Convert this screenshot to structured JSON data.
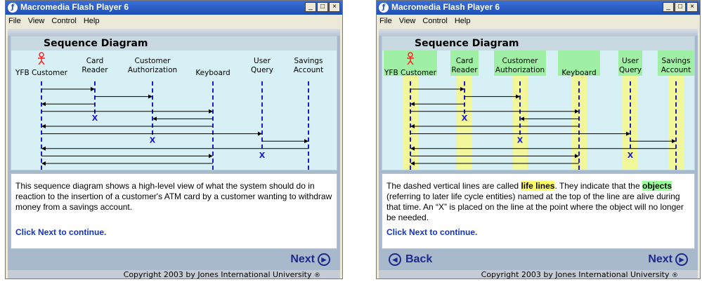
{
  "colors": {
    "title_bar": "#2452c0",
    "panel": "#d6f0f5",
    "lifeline": "#1c1ccc",
    "lane_highlight": "#f2f79a",
    "box_highlight": "#9ff0a4"
  },
  "windows": [
    {
      "title": "Macromedia Flash Player 6",
      "menu": [
        "File",
        "View",
        "Control",
        "Help"
      ],
      "heading": "Sequence Diagram",
      "description_parts": [
        {
          "text": "This sequence diagram shows a high-level view of what the system should do in reaction to the insertion of a customer's ATM card by a customer wanting to withdraw money from a savings account.",
          "style": "plain"
        }
      ],
      "cta": "Click Next to continue.",
      "next_label": "Next",
      "copyright": "Copyright 2003 by Jones International University",
      "registered_mark": "®"
    },
    {
      "title": "Macromedia Flash Player 6",
      "menu": [
        "File",
        "View",
        "Control",
        "Help"
      ],
      "heading": "Sequence Diagram",
      "description_parts": [
        {
          "text": "The dashed vertical lines are called ",
          "style": "plain"
        },
        {
          "text": "life lines",
          "style": "yellow"
        },
        {
          "text": ". They indicate that the ",
          "style": "plain"
        },
        {
          "text": "objects",
          "style": "green"
        },
        {
          "text": " (referring to later life cycle entities) named at the top of the line are alive during that time. An “X” is placed on the line at the point where the object will no longer be needed.",
          "style": "plain"
        }
      ],
      "cta": "Click Next to continue.",
      "back_label": "Back",
      "next_label": "Next",
      "copyright": "Copyright 2003 by Jones International University",
      "registered_mark": "®"
    }
  ],
  "window_controls": [
    "_",
    "□",
    "×"
  ],
  "icons": {
    "app": "flash-icon",
    "next": "next-arrow-icon",
    "back": "back-arrow-icon",
    "actor": "stick-figure-icon"
  },
  "diagram": {
    "objects": [
      [
        "YFB Customer"
      ],
      [
        "Card",
        "Reader"
      ],
      [
        "Customer",
        "Authorization"
      ],
      [
        "Keyboard"
      ],
      [
        "User",
        "Query"
      ],
      [
        "Savings",
        "Account"
      ]
    ],
    "messages": [
      {
        "from": 0,
        "to": 1
      },
      {
        "from": 1,
        "to": 2
      },
      {
        "from": 1,
        "to": 0
      },
      {
        "from": 0,
        "to": 3
      },
      {
        "from": 3,
        "to": 2
      },
      {
        "from": 3,
        "to": 0
      },
      {
        "from": 0,
        "to": 4
      },
      {
        "from": 4,
        "to": 5
      },
      {
        "from": 5,
        "to": 0
      },
      {
        "from": 0,
        "to": 3
      },
      {
        "from": 3,
        "to": 0
      }
    ],
    "destructions": [
      {
        "object": 1,
        "after_message": 3
      },
      {
        "object": 2,
        "after_message": 6
      },
      {
        "object": 4,
        "after_message": 8
      }
    ],
    "destroy_mark": "X"
  }
}
